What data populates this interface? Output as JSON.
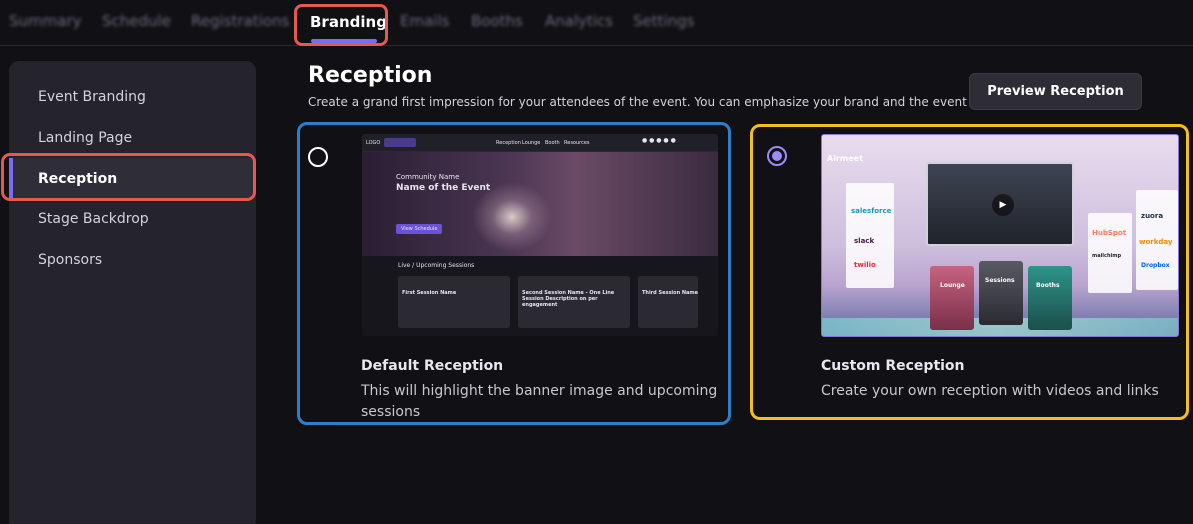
{
  "tabs": [
    "Summary",
    "Schedule",
    "Registrations",
    "Branding",
    "Emails",
    "Booths",
    "Analytics",
    "Settings"
  ],
  "sidebar": {
    "items": [
      "Event Branding",
      "Landing Page",
      "Reception",
      "Stage Backdrop",
      "Sponsors"
    ]
  },
  "header": {
    "title": "Reception",
    "subtitle": "Create a grand first impression for your attendees of the event. You can emphasize your brand and the event here.",
    "preview_label": "Preview Reception"
  },
  "options": {
    "default": {
      "title": "Default Reception",
      "description": "This will highlight the banner image and upcoming sessions",
      "selected": false
    },
    "custom": {
      "title": "Custom Reception",
      "description": "Create your own reception with videos and links",
      "selected": true
    }
  },
  "default_preview": {
    "logo": "LOGO",
    "nav": [
      "Reception",
      "Lounge",
      "Booth",
      "Resources"
    ],
    "community": "Community Name",
    "event": "Name of the Event",
    "schedule_btn": "View Schedule",
    "sessions_heading": "Live / Upcoming Sessions",
    "sessions": [
      "First Session Name",
      "Second Session Name - One Line Session Description on per engagement",
      "Third Session Name"
    ]
  },
  "custom_preview": {
    "brand": "Airmeet",
    "tiles": [
      "Lounge",
      "Sessions",
      "Booths"
    ],
    "logos_left": [
      "salesforce",
      "slack",
      "twilio"
    ],
    "logos_right": [
      "HubSpot",
      "zuora",
      "workday",
      "mailchimp",
      "Dropbox"
    ]
  },
  "colors": {
    "accent": "#7c6cf0",
    "highlight_red": "#e35a4e",
    "default_border": "#2f7fc8",
    "custom_border": "#f2bf1c"
  }
}
